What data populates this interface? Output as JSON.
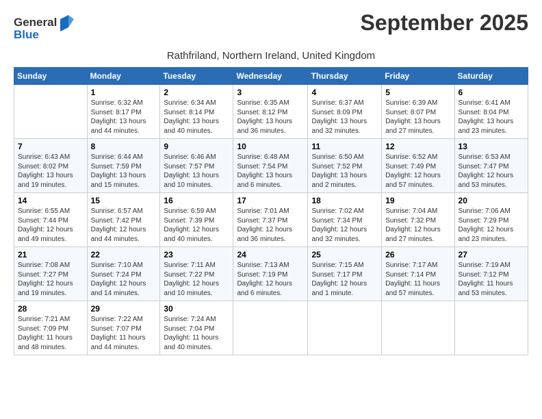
{
  "logo": {
    "line1": "General",
    "line2": "Blue"
  },
  "title": "September 2025",
  "subtitle": "Rathfriland, Northern Ireland, United Kingdom",
  "days_header": [
    "Sunday",
    "Monday",
    "Tuesday",
    "Wednesday",
    "Thursday",
    "Friday",
    "Saturday"
  ],
  "weeks": [
    [
      {
        "num": "",
        "info": ""
      },
      {
        "num": "1",
        "info": "Sunrise: 6:32 AM\nSunset: 8:17 PM\nDaylight: 13 hours\nand 44 minutes."
      },
      {
        "num": "2",
        "info": "Sunrise: 6:34 AM\nSunset: 8:14 PM\nDaylight: 13 hours\nand 40 minutes."
      },
      {
        "num": "3",
        "info": "Sunrise: 6:35 AM\nSunset: 8:12 PM\nDaylight: 13 hours\nand 36 minutes."
      },
      {
        "num": "4",
        "info": "Sunrise: 6:37 AM\nSunset: 8:09 PM\nDaylight: 13 hours\nand 32 minutes."
      },
      {
        "num": "5",
        "info": "Sunrise: 6:39 AM\nSunset: 8:07 PM\nDaylight: 13 hours\nand 27 minutes."
      },
      {
        "num": "6",
        "info": "Sunrise: 6:41 AM\nSunset: 8:04 PM\nDaylight: 13 hours\nand 23 minutes."
      }
    ],
    [
      {
        "num": "7",
        "info": "Sunrise: 6:43 AM\nSunset: 8:02 PM\nDaylight: 13 hours\nand 19 minutes."
      },
      {
        "num": "8",
        "info": "Sunrise: 6:44 AM\nSunset: 7:59 PM\nDaylight: 13 hours\nand 15 minutes."
      },
      {
        "num": "9",
        "info": "Sunrise: 6:46 AM\nSunset: 7:57 PM\nDaylight: 13 hours\nand 10 minutes."
      },
      {
        "num": "10",
        "info": "Sunrise: 6:48 AM\nSunset: 7:54 PM\nDaylight: 13 hours\nand 6 minutes."
      },
      {
        "num": "11",
        "info": "Sunrise: 6:50 AM\nSunset: 7:52 PM\nDaylight: 13 hours\nand 2 minutes."
      },
      {
        "num": "12",
        "info": "Sunrise: 6:52 AM\nSunset: 7:49 PM\nDaylight: 12 hours\nand 57 minutes."
      },
      {
        "num": "13",
        "info": "Sunrise: 6:53 AM\nSunset: 7:47 PM\nDaylight: 12 hours\nand 53 minutes."
      }
    ],
    [
      {
        "num": "14",
        "info": "Sunrise: 6:55 AM\nSunset: 7:44 PM\nDaylight: 12 hours\nand 49 minutes."
      },
      {
        "num": "15",
        "info": "Sunrise: 6:57 AM\nSunset: 7:42 PM\nDaylight: 12 hours\nand 44 minutes."
      },
      {
        "num": "16",
        "info": "Sunrise: 6:59 AM\nSunset: 7:39 PM\nDaylight: 12 hours\nand 40 minutes."
      },
      {
        "num": "17",
        "info": "Sunrise: 7:01 AM\nSunset: 7:37 PM\nDaylight: 12 hours\nand 36 minutes."
      },
      {
        "num": "18",
        "info": "Sunrise: 7:02 AM\nSunset: 7:34 PM\nDaylight: 12 hours\nand 32 minutes."
      },
      {
        "num": "19",
        "info": "Sunrise: 7:04 AM\nSunset: 7:32 PM\nDaylight: 12 hours\nand 27 minutes."
      },
      {
        "num": "20",
        "info": "Sunrise: 7:06 AM\nSunset: 7:29 PM\nDaylight: 12 hours\nand 23 minutes."
      }
    ],
    [
      {
        "num": "21",
        "info": "Sunrise: 7:08 AM\nSunset: 7:27 PM\nDaylight: 12 hours\nand 19 minutes."
      },
      {
        "num": "22",
        "info": "Sunrise: 7:10 AM\nSunset: 7:24 PM\nDaylight: 12 hours\nand 14 minutes."
      },
      {
        "num": "23",
        "info": "Sunrise: 7:11 AM\nSunset: 7:22 PM\nDaylight: 12 hours\nand 10 minutes."
      },
      {
        "num": "24",
        "info": "Sunrise: 7:13 AM\nSunset: 7:19 PM\nDaylight: 12 hours\nand 6 minutes."
      },
      {
        "num": "25",
        "info": "Sunrise: 7:15 AM\nSunset: 7:17 PM\nDaylight: 12 hours\nand 1 minute."
      },
      {
        "num": "26",
        "info": "Sunrise: 7:17 AM\nSunset: 7:14 PM\nDaylight: 11 hours\nand 57 minutes."
      },
      {
        "num": "27",
        "info": "Sunrise: 7:19 AM\nSunset: 7:12 PM\nDaylight: 11 hours\nand 53 minutes."
      }
    ],
    [
      {
        "num": "28",
        "info": "Sunrise: 7:21 AM\nSunset: 7:09 PM\nDaylight: 11 hours\nand 48 minutes."
      },
      {
        "num": "29",
        "info": "Sunrise: 7:22 AM\nSunset: 7:07 PM\nDaylight: 11 hours\nand 44 minutes."
      },
      {
        "num": "30",
        "info": "Sunrise: 7:24 AM\nSunset: 7:04 PM\nDaylight: 11 hours\nand 40 minutes."
      },
      {
        "num": "",
        "info": ""
      },
      {
        "num": "",
        "info": ""
      },
      {
        "num": "",
        "info": ""
      },
      {
        "num": "",
        "info": ""
      }
    ]
  ]
}
